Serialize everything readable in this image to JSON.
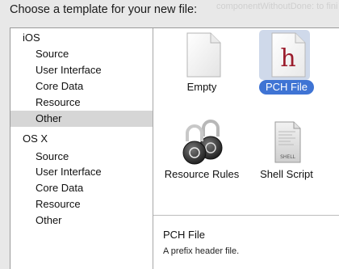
{
  "dialog": {
    "heading": "Choose a template for your new file:"
  },
  "background_text": "componentWithoutDone: to finish",
  "sidebar": {
    "groups": [
      {
        "label": "iOS",
        "items": [
          "Source",
          "User Interface",
          "Core Data",
          "Resource",
          "Other"
        ]
      },
      {
        "label": "OS X",
        "items": [
          "Source",
          "User Interface",
          "Core Data",
          "Resource",
          "Other"
        ]
      }
    ],
    "selected": {
      "group": 0,
      "item": 4
    }
  },
  "templates": [
    {
      "label": "Empty",
      "icon": "blank-document-icon"
    },
    {
      "label": "PCH File",
      "icon": "header-file-icon",
      "glyph": "h",
      "selected": true
    },
    {
      "label": "Resource Rules",
      "icon": "padlocks-icon"
    },
    {
      "label": "Shell Script",
      "icon": "shell-script-icon",
      "glyph": "SHELL"
    }
  ],
  "description": {
    "title": "PCH File",
    "text": "A prefix header file."
  },
  "colors": {
    "selection_blue": "#3f74d4",
    "sidebar_selected": "#d6d6d6",
    "header_glyph": "#9b1c2c"
  }
}
